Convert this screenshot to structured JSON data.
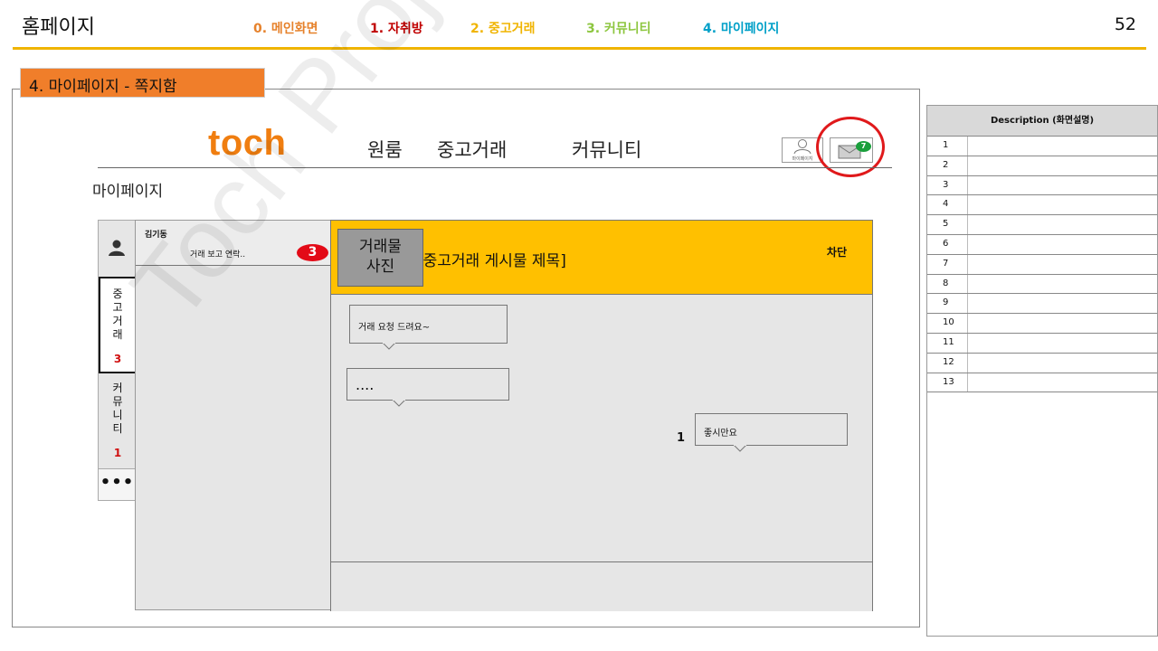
{
  "header": {
    "title": "홈페이지",
    "page_number": "52",
    "nav": [
      {
        "label": "0. 메인화면",
        "color": "#e6822c"
      },
      {
        "label": "1. 자취방",
        "color": "#c00000"
      },
      {
        "label": "2. 중고거래",
        "color": "#f0b400"
      },
      {
        "label": "3. 커뮤니티",
        "color": "#8dc63f"
      },
      {
        "label": "4. 마이페이지",
        "color": "#00a0c8"
      }
    ],
    "accent_color": "#f0b400"
  },
  "section_label": "4. 마이페이지 - 쪽지함",
  "site": {
    "logo": "toch",
    "nav": [
      "원룸",
      "중고거래",
      "커뮤니티"
    ],
    "user_button_caption": "마이페이지",
    "message_badge": "7",
    "page_label": "마이페이지"
  },
  "rail": {
    "tabs": [
      {
        "label": "중고거래",
        "count": "3",
        "active": true
      },
      {
        "label": "커뮤니티",
        "count": "1",
        "active": false
      }
    ],
    "more": "•••"
  },
  "conversation_list": {
    "items": [
      {
        "name": "김기동",
        "preview": "거래 보고 연락..",
        "unread": "3"
      }
    ]
  },
  "chat": {
    "photo_label": "거래물\n사진",
    "post_title": "[중고거래 게시물 제목]",
    "block_button": "차단",
    "messages": [
      {
        "text": "거래 요청 드려요~",
        "side": "left"
      },
      {
        "text": "....",
        "side": "left"
      },
      {
        "text": "좋시만요",
        "side": "right",
        "unread": "1"
      }
    ]
  },
  "watermark": "Toch Project",
  "description": {
    "header": "Description (화면설명)",
    "rows": [
      "1",
      "2",
      "3",
      "4",
      "5",
      "6",
      "7",
      "8",
      "9",
      "10",
      "11",
      "12",
      "13"
    ]
  }
}
